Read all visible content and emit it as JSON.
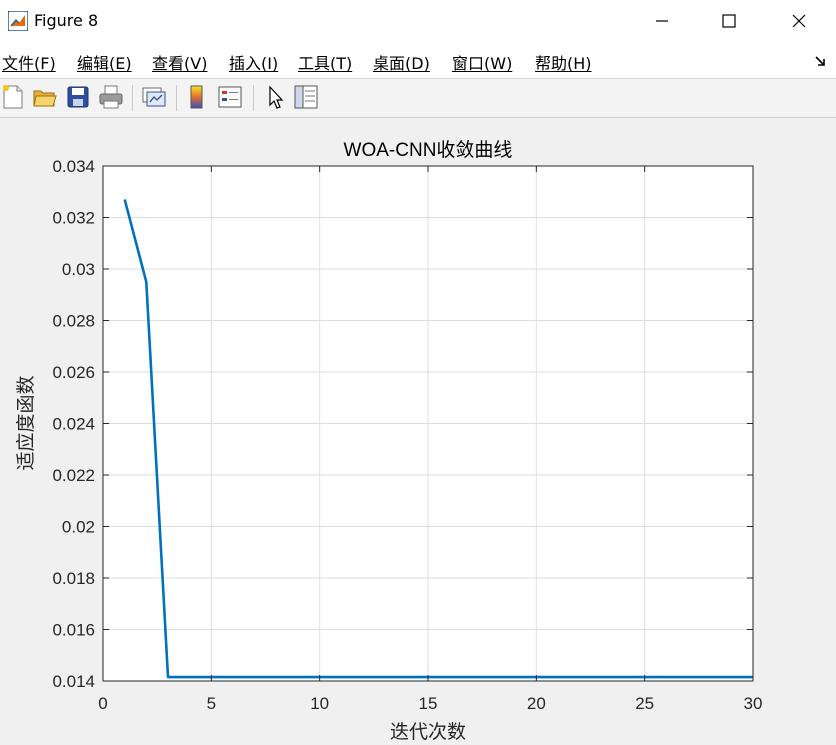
{
  "window": {
    "title": "Figure 8",
    "icon": "matlab-icon"
  },
  "menu": [
    "文件(F)",
    "编辑(E)",
    "查看(V)",
    "插入(I)",
    "工具(T)",
    "桌面(D)",
    "窗口(W)",
    "帮助(H)"
  ],
  "toolbar": [
    "new-figure-icon",
    "open-file-icon",
    "save-icon",
    "print-icon",
    "link-plot-icon",
    "colorbar-icon",
    "legend-icon",
    "edit-plot-icon",
    "property-inspector-icon"
  ],
  "chart_data": {
    "type": "line",
    "title": "WOA-CNN收敛曲线",
    "xlabel": "迭代次数",
    "ylabel": "适应度函数",
    "xlim": [
      0,
      30
    ],
    "ylim": [
      0.014,
      0.034
    ],
    "xticks": [
      0,
      5,
      10,
      15,
      20,
      25,
      30
    ],
    "yticks": [
      0.014,
      0.016,
      0.018,
      0.02,
      0.022,
      0.024,
      0.026,
      0.028,
      0.03,
      0.032,
      0.034
    ],
    "xtick_labels": [
      "0",
      "5",
      "10",
      "15",
      "20",
      "25",
      "30"
    ],
    "ytick_labels": [
      "0.014",
      "0.016",
      "0.018",
      "0.02",
      "0.022",
      "0.024",
      "0.026",
      "0.028",
      "0.03",
      "0.032",
      "0.034"
    ],
    "grid": true,
    "series": [
      {
        "color": "#0072bd",
        "x": [
          1,
          2,
          3,
          4,
          5,
          6,
          7,
          8,
          9,
          10,
          11,
          12,
          13,
          14,
          15,
          16,
          17,
          18,
          19,
          20,
          21,
          22,
          23,
          24,
          25,
          26,
          27,
          28,
          29,
          30
        ],
        "y": [
          0.0327,
          0.0295,
          0.01415,
          0.01415,
          0.01415,
          0.01415,
          0.01415,
          0.01415,
          0.01415,
          0.01415,
          0.01415,
          0.01415,
          0.01415,
          0.01415,
          0.01415,
          0.01415,
          0.01415,
          0.01415,
          0.01415,
          0.01415,
          0.01415,
          0.01415,
          0.01415,
          0.01415,
          0.01415,
          0.01415,
          0.01415,
          0.01415,
          0.01415,
          0.01415
        ]
      }
    ]
  }
}
